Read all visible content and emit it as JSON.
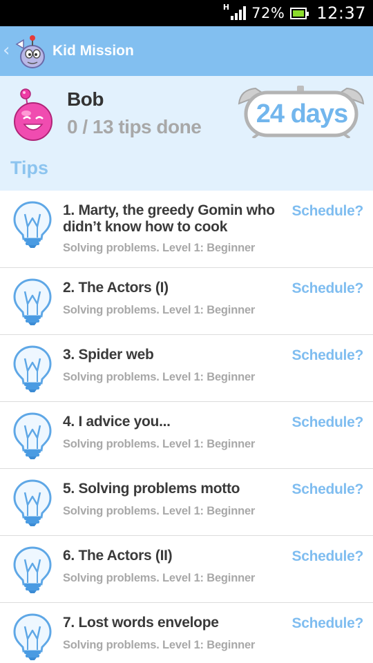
{
  "status_bar": {
    "network_label": "H",
    "battery_percent": "72%",
    "time": "12:37",
    "battery_color": "#8bdc2c"
  },
  "app_bar": {
    "title": "Kid Mission",
    "back_icon": "chevron-left-icon",
    "logo_icon": "mascot-logo-icon",
    "color": "#82bff0"
  },
  "profile": {
    "name": "Bob",
    "progress": "0 / 13 tips done",
    "days": "24 days",
    "avatar_icon": "pink-smiley-avatar-icon",
    "clock_icon": "alarm-clock-icon"
  },
  "section_title": "Tips",
  "tips": [
    {
      "title": "1. Marty, the greedy Gomin who didn’t know how to cook",
      "subtitle": "Solving problems. Level 1: Beginner",
      "action": "Schedule?"
    },
    {
      "title": "2. The Actors (I)",
      "subtitle": "Solving problems. Level 1: Beginner",
      "action": "Schedule?"
    },
    {
      "title": "3. Spider web",
      "subtitle": "Solving problems. Level 1: Beginner",
      "action": "Schedule?"
    },
    {
      "title": "4. I advice you...",
      "subtitle": "Solving problems. Level 1: Beginner",
      "action": "Schedule?"
    },
    {
      "title": "5. Solving problems motto",
      "subtitle": "Solving problems. Level 1: Beginner",
      "action": "Schedule?"
    },
    {
      "title": "6. The Actors (II)",
      "subtitle": "Solving problems. Level 1: Beginner",
      "action": "Schedule?"
    },
    {
      "title": "7. Lost words envelope",
      "subtitle": "Solving problems. Level 1: Beginner",
      "action": "Schedule?"
    }
  ],
  "tip_icon": "lightbulb-icon",
  "accent_color": "#7fbdf0"
}
